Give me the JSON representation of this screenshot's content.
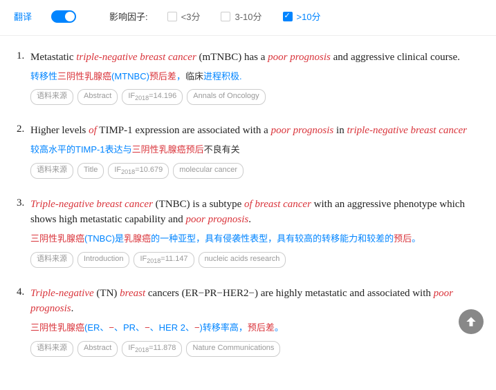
{
  "topbar": {
    "translate_label": "翻译",
    "if_label": "影响因子:",
    "filters": [
      {
        "label": "<3分",
        "checked": false
      },
      {
        "label": "3-10分",
        "checked": false
      },
      {
        "label": ">10分",
        "checked": true
      }
    ]
  },
  "results": [
    {
      "num": "1.",
      "en": [
        [
          "Metastatic ",
          0
        ],
        [
          "triple",
          1
        ],
        [
          "-",
          1
        ],
        [
          "negative breast cancer",
          1
        ],
        [
          " (mTNBC) has a ",
          0
        ],
        [
          "poor prognosis",
          1
        ],
        [
          " and aggressive clinical course.",
          0
        ]
      ],
      "zh": [
        [
          "转移性",
          0
        ],
        [
          "三阴性乳腺癌",
          1
        ],
        [
          "(MTNBC)",
          0
        ],
        [
          "预后差",
          1
        ],
        [
          "，",
          0
        ],
        [
          "临床",
          2
        ],
        [
          "进程积极.",
          0
        ]
      ],
      "tags": [
        "语料来源",
        "Abstract",
        "IF|2018|=14.196",
        "Annals of Oncology"
      ]
    },
    {
      "num": "2.",
      "en": [
        [
          "Higher levels ",
          0
        ],
        [
          "of",
          1
        ],
        [
          " TIMP-1 expression are associated with a ",
          0
        ],
        [
          "poor prognosis",
          1
        ],
        [
          " in ",
          0
        ],
        [
          "triple",
          1
        ],
        [
          "-",
          1
        ],
        [
          "negative breast cancer",
          1
        ]
      ],
      "zh": [
        [
          "较高水平的TIMP-1表达与",
          0
        ],
        [
          "三阴性乳腺癌预后",
          1
        ],
        [
          "不良有关",
          2
        ]
      ],
      "tags": [
        "语料来源",
        "Title",
        "IF|2018|=10.679",
        "molecular cancer"
      ]
    },
    {
      "num": "3.",
      "en": [
        [
          "Triple",
          1
        ],
        [
          "-",
          1
        ],
        [
          "negative breast cancer",
          1
        ],
        [
          " (TNBC) is a subtype ",
          0
        ],
        [
          "of breast cancer",
          1
        ],
        [
          " with an aggressive phenotype which shows high metastatic capability and ",
          0
        ],
        [
          "poor prognosis",
          1
        ],
        [
          ".",
          0
        ]
      ],
      "zh": [
        [
          "三阴性乳腺癌",
          1
        ],
        [
          "(TNBC)是",
          0
        ],
        [
          "乳腺癌",
          1
        ],
        [
          "的一种亚型，具有侵袭性表型，具有较高的转移能力和较差的",
          0
        ],
        [
          "预后",
          1
        ],
        [
          "。",
          0
        ]
      ],
      "tags": [
        "语料来源",
        "Introduction",
        "IF|2018|=11.147",
        "nucleic acids research"
      ]
    },
    {
      "num": "4.",
      "en": [
        [
          "Triple",
          1
        ],
        [
          "-",
          1
        ],
        [
          "negative",
          1
        ],
        [
          " (TN) ",
          0
        ],
        [
          "breast",
          1
        ],
        [
          " cancers (ER−PR−HER2−) are highly metastatic and associated with ",
          0
        ],
        [
          "poor prognosis",
          1
        ],
        [
          ".",
          0
        ]
      ],
      "zh": [
        [
          "三阴性乳腺癌",
          1
        ],
        [
          "(ER、",
          0
        ],
        [
          "−",
          1
        ],
        [
          "、PR、",
          0
        ],
        [
          "−",
          1
        ],
        [
          "、HER 2、",
          0
        ],
        [
          "−",
          1
        ],
        [
          ")转移率高，",
          0
        ],
        [
          "预后差",
          1
        ],
        [
          "。",
          0
        ]
      ],
      "tags": [
        "语料来源",
        "Abstract",
        "IF|2018|=11.878",
        "Nature Communications"
      ]
    }
  ]
}
